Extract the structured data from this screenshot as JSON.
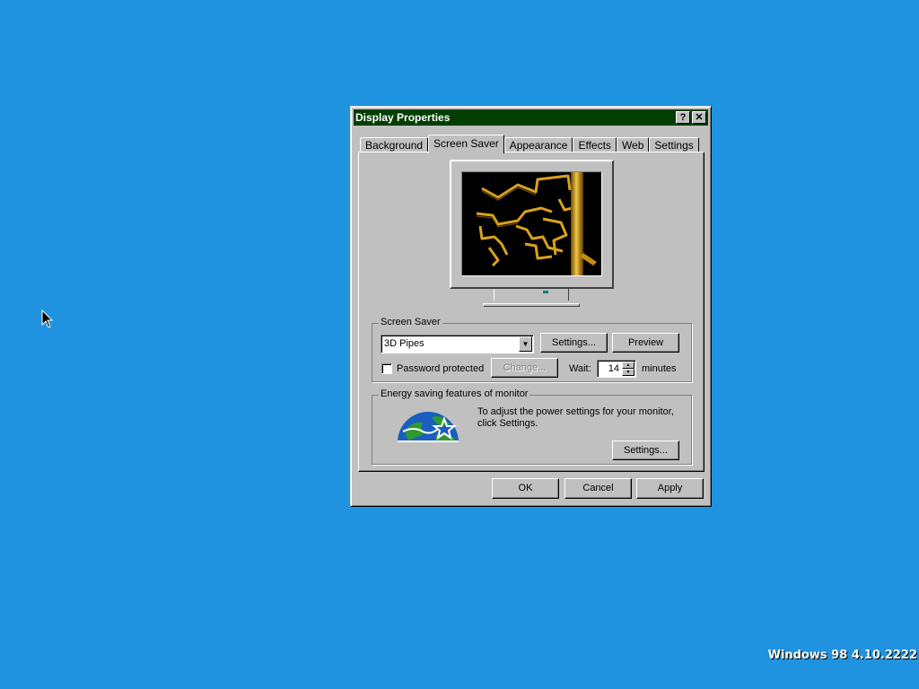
{
  "window": {
    "title": "Display Properties",
    "help_button": "?",
    "close_button": "✕"
  },
  "tabs": [
    {
      "label": "Background"
    },
    {
      "label": "Screen Saver"
    },
    {
      "label": "Appearance"
    },
    {
      "label": "Effects"
    },
    {
      "label": "Web"
    },
    {
      "label": "Settings"
    }
  ],
  "active_tab": "Screen Saver",
  "screen_saver": {
    "group_label": "Screen Saver",
    "selected": "3D Pipes",
    "settings_button": "Settings...",
    "preview_button": "Preview",
    "password_label": "Password protected",
    "password_checked": false,
    "change_button": "Change...",
    "wait_label": "Wait:",
    "wait_value": "14",
    "minutes_label": "minutes"
  },
  "energy": {
    "group_label": "Energy saving features of monitor",
    "logo_name": "energy-star-logo",
    "description": "To adjust the power settings for your monitor, click Settings.",
    "settings_button": "Settings..."
  },
  "buttons": {
    "ok": "OK",
    "cancel": "Cancel",
    "apply": "Apply"
  },
  "desktop": {
    "version_text": "Windows 98 4.10.2222",
    "background_color": "#1f93df",
    "titlebar_color": "#003f00"
  }
}
